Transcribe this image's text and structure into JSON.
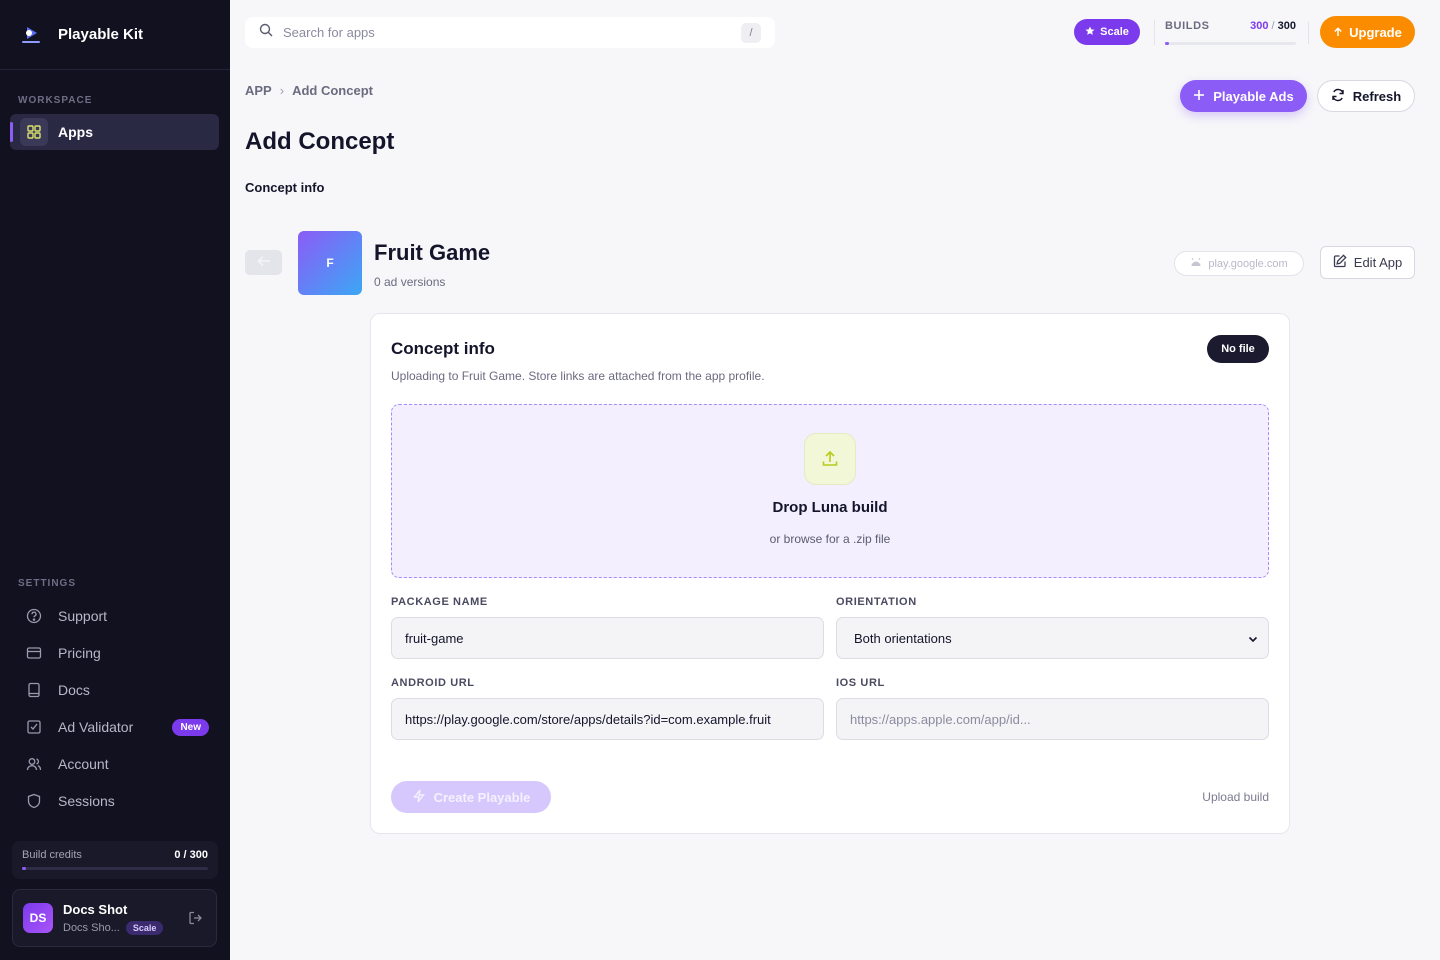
{
  "brand": {
    "name": "Playable Kit"
  },
  "sidebar": {
    "workspace_label": "WORKSPACE",
    "workspace_items": [
      {
        "label": "Apps",
        "icon": "grid-icon",
        "active": true
      }
    ],
    "settings_label": "SETTINGS",
    "settings_items": [
      {
        "label": "Support",
        "icon": "help-circle-icon"
      },
      {
        "label": "Pricing",
        "icon": "credit-card-icon"
      },
      {
        "label": "Docs",
        "icon": "book-icon"
      },
      {
        "label": "Ad Validator",
        "icon": "check-square-icon",
        "badge": "New"
      },
      {
        "label": "Account",
        "icon": "users-icon"
      },
      {
        "label": "Sessions",
        "icon": "shield-icon"
      }
    ],
    "credits": {
      "label": "Build credits",
      "value": "0 / 300",
      "used_fraction": 0.02
    },
    "user": {
      "initials": "DS",
      "name": "Docs Shot",
      "sub": "Docs Sho...",
      "plan": "Scale"
    }
  },
  "topbar": {
    "search_placeholder": "Search for apps",
    "search_shortcut": "/",
    "plan": "Scale",
    "builds": {
      "label": "BUILDS",
      "current": "300",
      "separator": "/",
      "total": "300",
      "progress_fraction": 0.03
    },
    "upgrade_label": "Upgrade"
  },
  "page": {
    "breadcrumb": {
      "root": "APP",
      "separator": "›",
      "current": "Add Concept"
    },
    "actions": {
      "playable_ads": "Playable Ads",
      "refresh": "Refresh"
    },
    "title": "Add Concept",
    "subtitle": "Concept info"
  },
  "app": {
    "tile_letter": "F",
    "name": "Fruit Game",
    "versions": "0 ad versions",
    "store_chip": "play.google.com",
    "edit_label": "Edit App"
  },
  "card": {
    "title": "Concept info",
    "description": "Uploading to Fruit Game. Store links are attached from the app profile.",
    "file_status": "No file",
    "dropzone": {
      "title": "Drop Luna build",
      "sub": "or browse for a .zip file"
    },
    "package_label": "PACKAGE NAME",
    "package_value": "fruit-game",
    "orientation_label": "ORIENTATION",
    "orientation_value": "Both orientations",
    "android_label": "ANDROID URL",
    "android_value": "https://play.google.com/store/apps/details?id=com.example.fruit",
    "ios_label": "IOS URL",
    "ios_placeholder": "https://apps.apple.com/app/id...",
    "create_label": "Create Playable",
    "upload_link": "Upload build"
  },
  "colors": {
    "accent": "#8b5cf6",
    "upgrade": "#fb8c00",
    "sidebar_bg": "#12111f"
  }
}
